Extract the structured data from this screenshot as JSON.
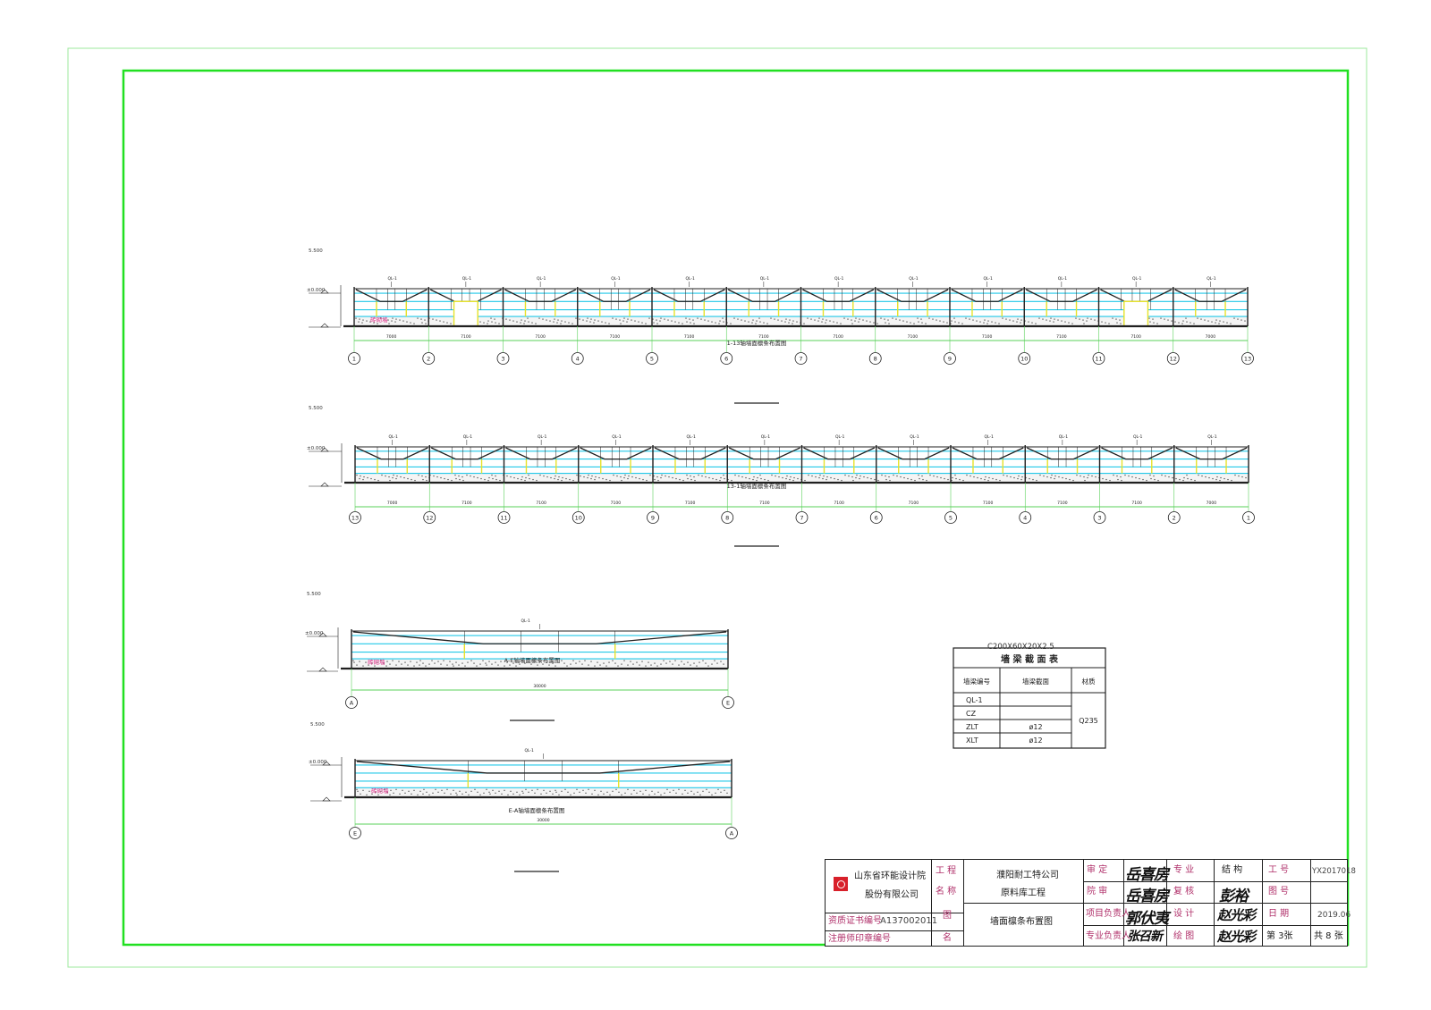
{
  "colors": {
    "frame": "#21e021",
    "cyan": "#22c8e8",
    "yellow": "#e6e22a",
    "magenta": "#e0308a",
    "dim": "#20c020",
    "ink": "#202020"
  },
  "elevations": [
    {
      "id": "elev-1-13",
      "title": "1-13轴墙面檩条布置图",
      "elev_top": "5.500",
      "elev_zero": "±0.000",
      "axes": [
        "1",
        "2",
        "3",
        "4",
        "5",
        "6",
        "7",
        "8",
        "9",
        "10",
        "11",
        "12",
        "13"
      ],
      "spans": [
        "7000",
        "7100",
        "7100",
        "7100",
        "7100",
        "7100",
        "7100",
        "7100",
        "7100",
        "7100",
        "7100",
        "7000"
      ],
      "purlin_label": "QL-1",
      "note": "砖砌墙",
      "door_bays": [
        1,
        10
      ]
    },
    {
      "id": "elev-13-1",
      "title": "13-1轴墙面檩条布置图",
      "elev_top": "5.500",
      "elev_zero": "±0.000",
      "axes": [
        "13",
        "12",
        "11",
        "10",
        "9",
        "8",
        "7",
        "6",
        "5",
        "4",
        "3",
        "2",
        "1"
      ],
      "spans": [
        "7000",
        "7100",
        "7100",
        "7100",
        "7100",
        "7100",
        "7100",
        "7100",
        "7100",
        "7100",
        "7100",
        "7000"
      ],
      "purlin_label": "QL-1",
      "note": "",
      "door_bays": []
    },
    {
      "id": "elev-a-e",
      "title": "A-E轴墙面檩条布置图",
      "elev_top": "5.500",
      "elev_zero": "±0.000",
      "axes": [
        "A",
        "E"
      ],
      "spans": [
        "30000"
      ],
      "purlin_label": "QL-1",
      "note": "砖砌墙",
      "door_bays": []
    },
    {
      "id": "elev-e-a",
      "title": "E-A轴墙面檩条布置图",
      "elev_top": "5.500",
      "elev_zero": "±0.000",
      "axes": [
        "E",
        "A"
      ],
      "spans": [
        "30000"
      ],
      "purlin_label": "QL-1",
      "note": "砖砌墙",
      "door_bays": []
    }
  ],
  "purlin_table": {
    "overlay": "C200X60X20X2.5",
    "title": "墙 梁 截 面 表",
    "headers": [
      "墙梁编号",
      "墙梁截面",
      "材质"
    ],
    "rows": [
      {
        "id": "QL-1",
        "section": ""
      },
      {
        "id": "CZ",
        "section": ""
      },
      {
        "id": "ZLT",
        "section": "ø12"
      },
      {
        "id": "XLT",
        "section": "ø12"
      }
    ],
    "material": "Q235"
  },
  "title_block": {
    "company_1": "山东省环能设计院",
    "company_2": "股份有限公司",
    "cert_label": "资质证书编号",
    "cert_value": "A137002011",
    "seal_label": "注册师印章编号",
    "project_label_1": "工 程",
    "project_label_2": "名 称",
    "client": "濮阳耐工特公司",
    "project_name": "原料库工程",
    "drawing_label_1": "图",
    "drawing_label_2": "名",
    "drawing_name": "墙面檩条布置图",
    "approve_label": "审 定",
    "review_label": "院 审",
    "pm_label": "项目负责人",
    "discipline_lead_label": "专业负责人",
    "signature_approve": "岳喜房",
    "signature_review": "岳喜房",
    "signature_pm": "郭伏夷",
    "signature_lead": "张召新",
    "discipline_label": "专 业",
    "discipline_value": "结 构",
    "check_label": "复 核",
    "design_label": "设 计",
    "draw_label": "绘 图",
    "signature_check": "彭裕",
    "signature_design": "赵光彩",
    "signature_draw": "赵光彩",
    "job_label": "工 号",
    "job_value": "YX2017018",
    "drawing_no_label": "图 号",
    "date_label": "日 期",
    "date_value": "2019.06",
    "sheet_value": "第 3张",
    "total_value": "共 8 张"
  }
}
